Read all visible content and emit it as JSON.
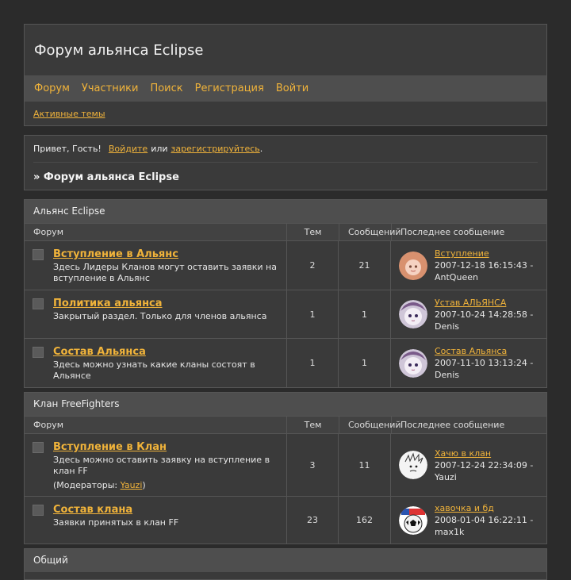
{
  "site": {
    "title": "Форум альянса Eclipse",
    "nav": [
      "Форум",
      "Участники",
      "Поиск",
      "Регистрация",
      "Войти"
    ],
    "active_topics": "Активные темы"
  },
  "welcome": {
    "greeting": "Привет, Гость!",
    "login": "Войдите",
    "or": "или",
    "register": "зарегистрируйтесь",
    "period": ".",
    "breadcrumb": "» Форум альянса Eclipse"
  },
  "columns": {
    "forum": "Форум",
    "topics": "Тем",
    "posts": "Сообщений",
    "last_post": "Последнее сообщение"
  },
  "categories": [
    {
      "title": "Альянс Eclipse",
      "forums": [
        {
          "title": "Вступление в Альянс",
          "desc": "Здесь Лидеры Кланов могут оставить заявки на вступление в Альянс",
          "topics": "2",
          "posts": "21",
          "last_topic": "Вступление",
          "last_date": "2007-12-18 16:15:43 -",
          "last_user": "AntQueen",
          "avatar": "girl-avatar"
        },
        {
          "title": "Политика альянса",
          "desc": "Закрытый раздел. Только для членов альянса",
          "topics": "1",
          "posts": "1",
          "last_topic": "Устав АЛЬЯНСА",
          "last_date": "2007-10-24 14:28:58 -",
          "last_user": "Denis",
          "avatar": "anime-avatar"
        },
        {
          "title": "Состав Альянса",
          "desc": "Здесь можно узнать какие кланы состоят в Альянсе",
          "topics": "1",
          "posts": "1",
          "last_topic": "Состав Альянса",
          "last_date": "2007-11-10 13:13:24 -",
          "last_user": "Denis",
          "avatar": "anime-avatar"
        }
      ]
    },
    {
      "title": "Клан FreeFighters",
      "forums": [
        {
          "title": "Вступление в Клан",
          "desc": "Здесь можно оставить заявку на вступление в клан FF",
          "mods_prefix": "(Модераторы: ",
          "mods_user": "Yauzi",
          "mods_suffix": ")",
          "topics": "3",
          "posts": "11",
          "last_topic": "Хачю в клан",
          "last_date": "2007-12-24 22:34:09 -",
          "last_user": "Yauzi",
          "avatar": "sketch-avatar"
        },
        {
          "title": "Состав клана",
          "desc": "Заявки принятых в клан FF",
          "topics": "23",
          "posts": "162",
          "last_topic": "хавочка и бд",
          "last_date": "2008-01-04 16:22:11 -",
          "last_user": "max1k",
          "avatar": "ball-avatar"
        }
      ]
    },
    {
      "title": "Общий",
      "forums": []
    }
  ],
  "colors": {
    "accent": "#f0b33a",
    "background": "#2b2b2b",
    "panel": "#3a3a3a",
    "bar": "#4e4e4e"
  }
}
